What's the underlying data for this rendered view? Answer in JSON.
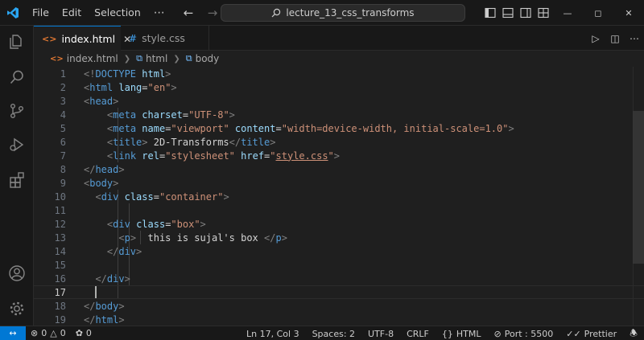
{
  "titlebar": {
    "menu": [
      "File",
      "Edit",
      "Selection"
    ],
    "more": "⋯",
    "search_text": "lecture_13_css_transforms"
  },
  "tabs": [
    {
      "label": "index.html",
      "icon": "html-file-icon",
      "active": true
    },
    {
      "label": "style.css",
      "icon": "css-file-icon",
      "active": false
    }
  ],
  "breadcrumb": [
    "index.html",
    "html",
    "body"
  ],
  "editor": {
    "current_line": 17,
    "lines": [
      {
        "n": "1"
      },
      {
        "n": "2"
      },
      {
        "n": "3"
      },
      {
        "n": "4"
      },
      {
        "n": "5"
      },
      {
        "n": "6"
      },
      {
        "n": "7"
      },
      {
        "n": "8"
      },
      {
        "n": "9"
      },
      {
        "n": "10"
      },
      {
        "n": "11"
      },
      {
        "n": "12"
      },
      {
        "n": "13"
      },
      {
        "n": "14"
      },
      {
        "n": "15"
      },
      {
        "n": "16"
      },
      {
        "n": "17"
      },
      {
        "n": "18"
      },
      {
        "n": "19"
      }
    ],
    "code": {
      "doctype": "DOCTYPE",
      "html_kw": "html",
      "lang_attr": "lang",
      "lang_val": "\"en\"",
      "head": "head",
      "meta": "meta",
      "charset_attr": "charset",
      "charset_val": "\"UTF-8\"",
      "name_attr": "name",
      "name_val": "\"viewport\"",
      "content_attr": "content",
      "content_val": "\"width=device-width, initial-scale=1.0\"",
      "title": "title",
      "title_text": "2D-Transforms",
      "link": "link",
      "rel_attr": "rel",
      "rel_val": "\"stylesheet\"",
      "href_attr": "href",
      "href_q": "\"",
      "href_val": "style.css",
      "body": "body",
      "div": "div",
      "class_attr": "class",
      "container_val": "\"container\"",
      "box_val": "\"box\"",
      "p": "p",
      "p_text": "  this is sujal's box "
    }
  },
  "statusbar": {
    "remote_icon": "↔",
    "errors": "0",
    "warnings": "0",
    "ports": "0",
    "position": "Ln 17, Col 3",
    "spaces": "Spaces: 2",
    "encoding": "UTF-8",
    "eol": "CRLF",
    "language": "HTML",
    "port": "Port : 5500",
    "prettier": "Prettier"
  },
  "colors": {
    "accent": "#0078d4",
    "tag": "#569cd6",
    "attr": "#9cdcfe",
    "string": "#ce9178",
    "background": "#1f1f1f"
  }
}
